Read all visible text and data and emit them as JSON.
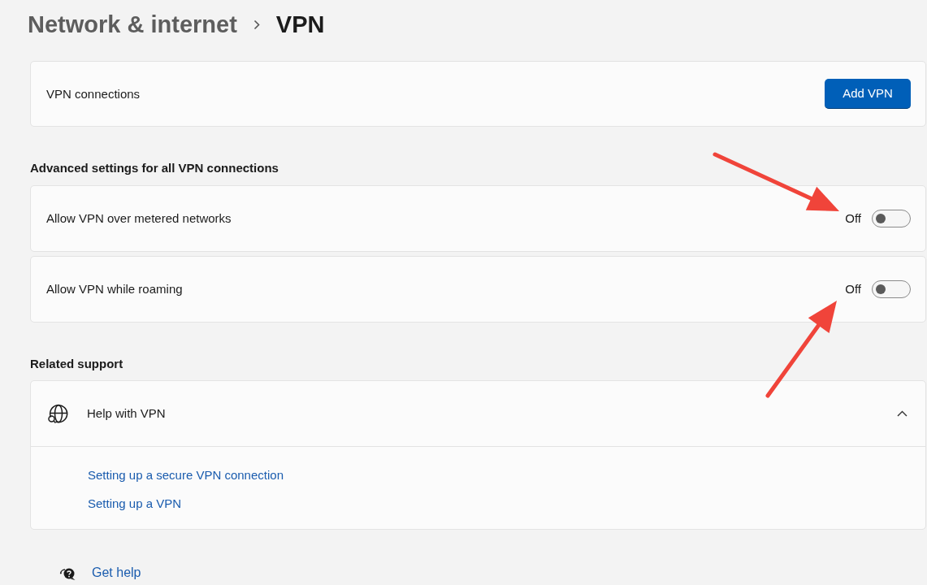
{
  "breadcrumb": [
    {
      "label": "Network & internet",
      "current": false
    },
    {
      "label": "VPN",
      "current": true
    }
  ],
  "vpn_connections": {
    "label": "VPN connections",
    "button": "Add VPN"
  },
  "advanced_settings": {
    "heading": "Advanced settings for all VPN connections",
    "toggles": [
      {
        "label": "Allow VPN over metered networks",
        "state_text": "Off",
        "on": false
      },
      {
        "label": "Allow VPN while roaming",
        "state_text": "Off",
        "on": false
      }
    ]
  },
  "related_support": {
    "heading": "Related support",
    "help": {
      "title": "Help with VPN",
      "expanded": true,
      "links": [
        "Setting up a secure VPN connection",
        "Setting up a VPN"
      ]
    }
  },
  "get_help": "Get help"
}
